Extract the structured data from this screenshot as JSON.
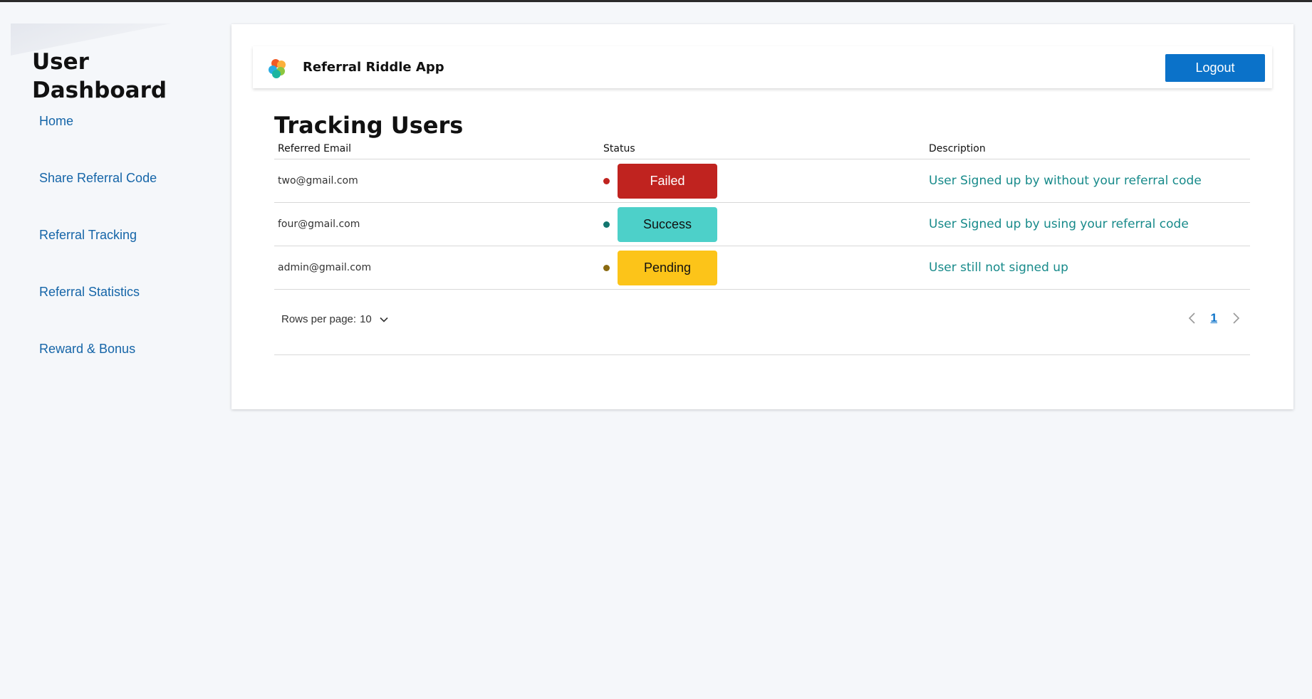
{
  "sidebar": {
    "title_line1": "User",
    "title_line2": "Dashboard",
    "items": [
      {
        "label": "Home"
      },
      {
        "label": "Share Referral Code"
      },
      {
        "label": "Referral Tracking"
      },
      {
        "label": "Referral Statistics"
      },
      {
        "label": "Reward & Bonus"
      }
    ]
  },
  "header": {
    "app_name": "Referral Riddle App",
    "logout_label": "Logout"
  },
  "main": {
    "title": "Tracking Users",
    "columns": [
      "Referred Email",
      "Status",
      "Description"
    ],
    "rows": [
      {
        "email": "two@gmail.com",
        "status": "Failed",
        "description": "User Signed up by without your referral code"
      },
      {
        "email": "four@gmail.com",
        "status": "Success",
        "description": "User Signed up by using your referral code"
      },
      {
        "email": "admin@gmail.com",
        "status": "Pending",
        "description": "User still not signed up"
      }
    ],
    "pagination": {
      "rows_per_page_label": "Rows per page:",
      "rows_per_page_value": "10",
      "current_page": "1"
    }
  },
  "colors": {
    "accent": "#0b72c9",
    "failed": "#c0231f",
    "success": "#4dd0c9",
    "pending": "#fcc419",
    "description_text": "#178a8a",
    "failed_dot": "#c0231f",
    "success_dot": "#13766f",
    "pending_dot": "#8a6a11"
  }
}
